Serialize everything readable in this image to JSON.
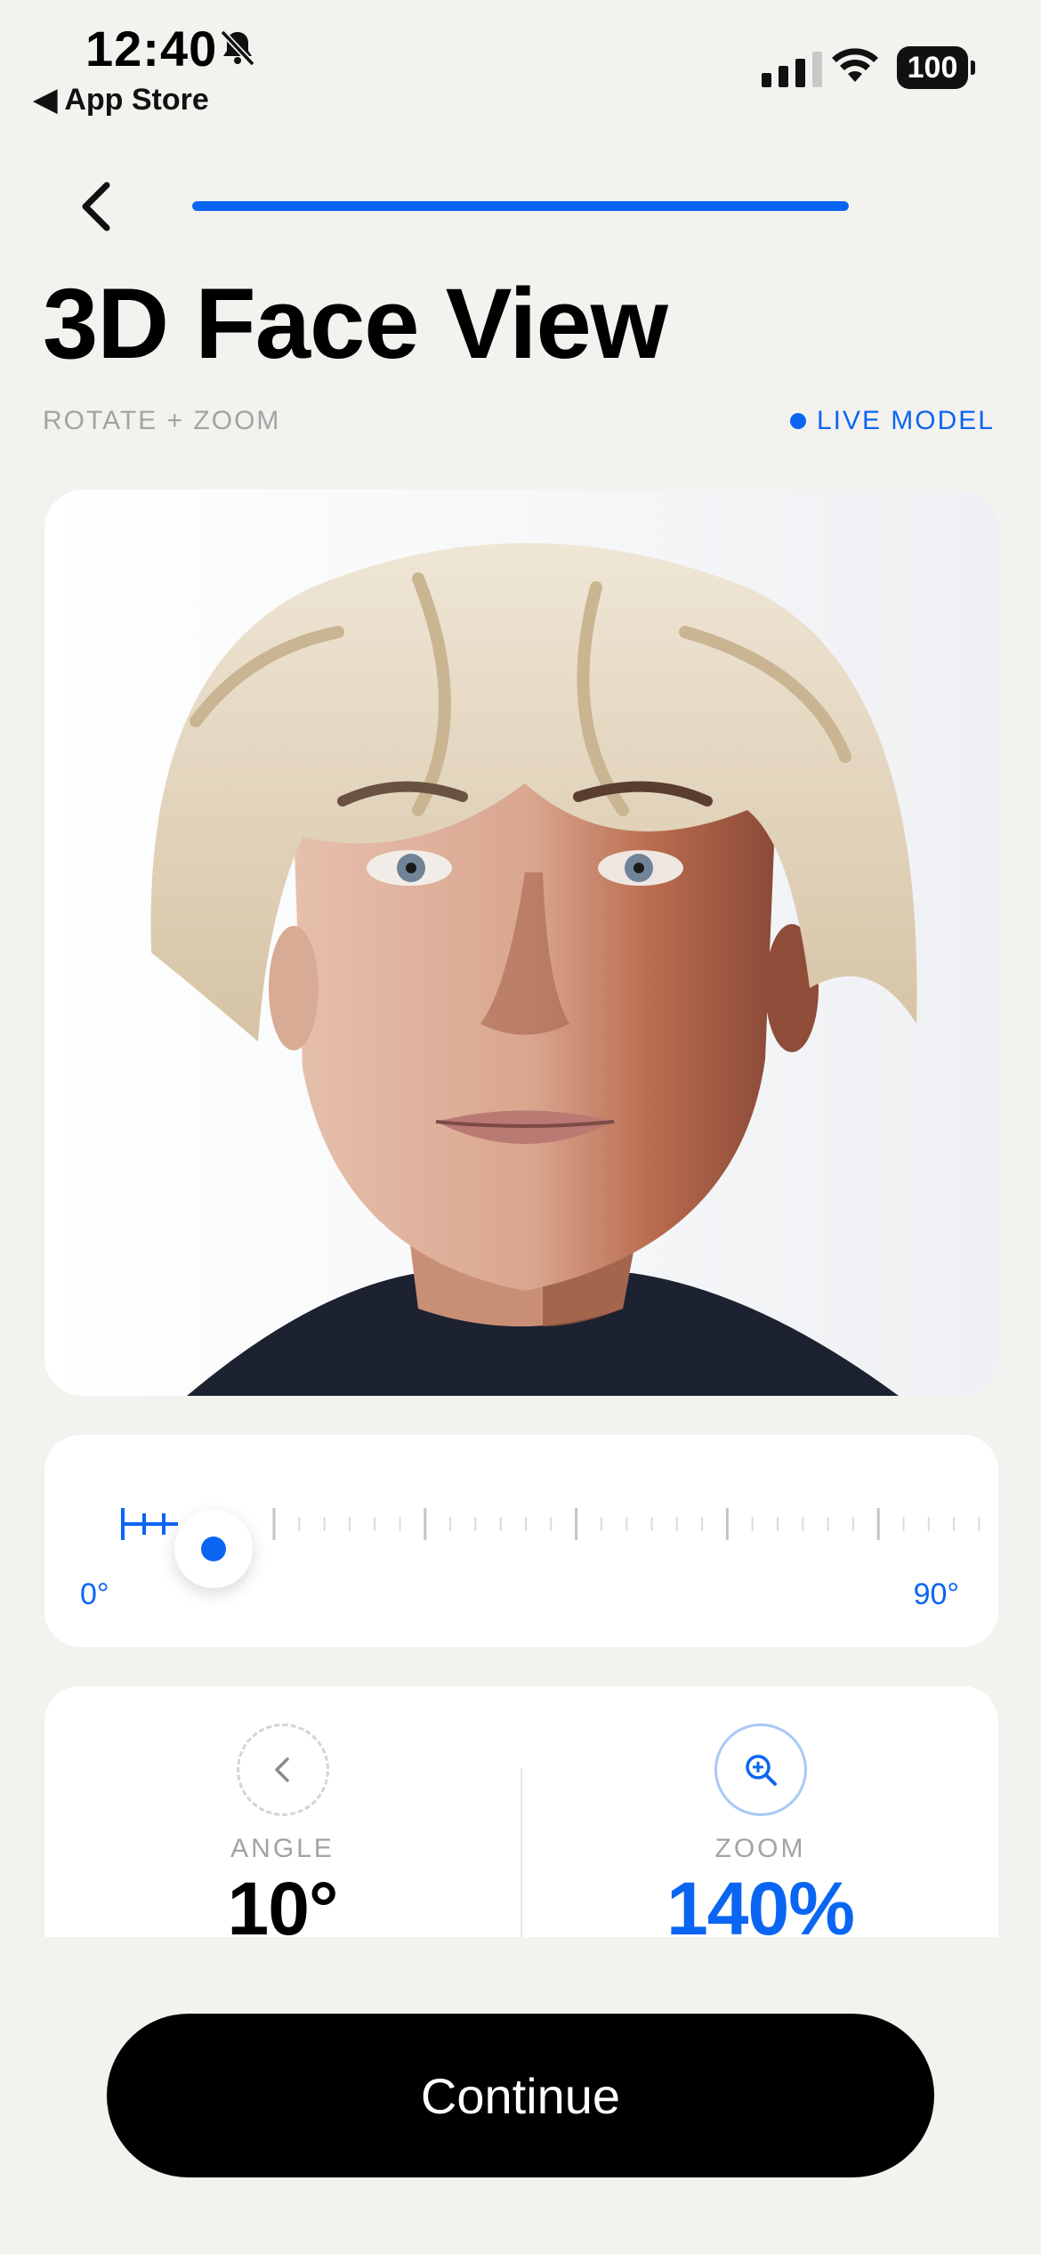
{
  "status_bar": {
    "time": "12:40",
    "back_app": "◀ App Store",
    "battery": "100",
    "icons": [
      "bell-slash-icon",
      "signal-icon",
      "wifi-icon",
      "battery-icon"
    ]
  },
  "header": {
    "onboarding_progress": 1.0,
    "title": "3D Face View",
    "subtitle": "ROTATE + ZOOM",
    "live_badge": "LIVE MODEL"
  },
  "slider": {
    "min_label": "0°",
    "max_label": "90°",
    "value_degrees": 10
  },
  "stats": {
    "angle": {
      "label": "ANGLE",
      "value": "10°",
      "icon": "chevron-left-icon"
    },
    "zoom": {
      "label": "ZOOM",
      "value": "140%",
      "icon": "zoom-in-icon"
    }
  },
  "continue_label": "Continue",
  "colors": {
    "accent": "#0a66f2",
    "background": "#f3f2ef",
    "card": "#ffffff",
    "muted_text": "#a3a3a3",
    "button": "#000000"
  }
}
